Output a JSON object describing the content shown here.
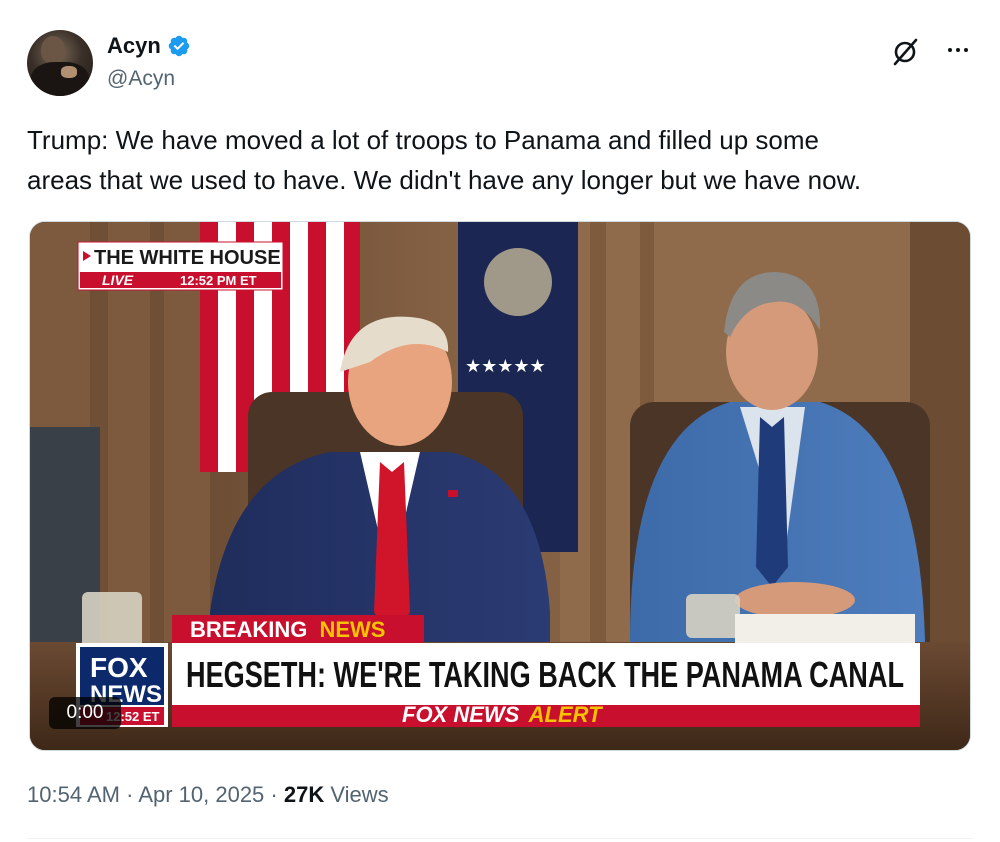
{
  "author": {
    "display_name": "Acyn",
    "handle": "@Acyn",
    "verified_color": "#1d9bf0"
  },
  "icons": {
    "verified": "verified-badge-icon",
    "grok": "grok-icon",
    "more": "more-options-icon"
  },
  "tweet": {
    "line1": "Trump: We have moved a lot of troops to Panama and filled up some",
    "line2": "areas that we used to have. We didn't have any longer but we have now."
  },
  "video": {
    "timer": "0:00",
    "bug_title": "THE WHITE HOUSE",
    "bug_live": "LIVE",
    "bug_time": "12:52 PM ET",
    "breaking_word1": "BREAKING",
    "breaking_word2": "NEWS",
    "headline": "HEGSETH: WE'RE TAKING BACK THE PANAMA CANAL",
    "alert_brand": "FOX NEWS",
    "alert_word": "ALERT",
    "logo_line1": "FOX",
    "logo_line2": "NEWS",
    "logo_time": "12:52 ET",
    "colors": {
      "red": "#c8102e",
      "navy": "#0c2a6b",
      "gold": "#f6c300"
    }
  },
  "meta": {
    "time": "10:54 AM",
    "sep1": "·",
    "date": "Apr 10, 2025",
    "sep2": "·",
    "views_count": "27K",
    "views_label": "Views"
  }
}
